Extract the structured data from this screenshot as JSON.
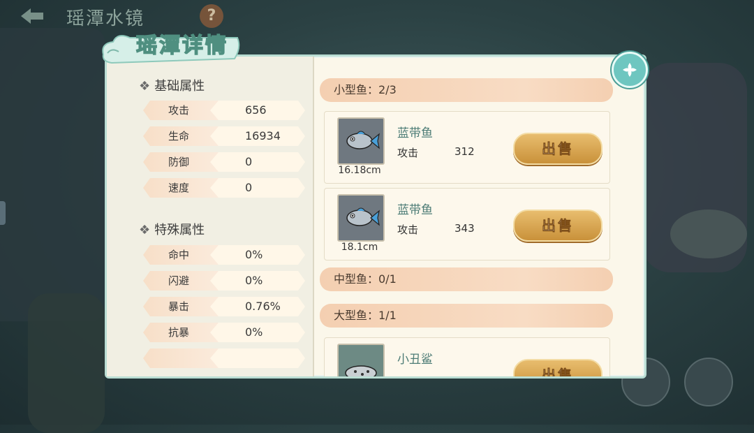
{
  "scene": {
    "title": "瑶潭水镜",
    "help_label": "?"
  },
  "panel": {
    "title": "瑶潭详情"
  },
  "basic_section": {
    "title": "基础属性",
    "stats": [
      {
        "label": "攻击",
        "value": "656"
      },
      {
        "label": "生命",
        "value": "16934"
      },
      {
        "label": "防御",
        "value": "0"
      },
      {
        "label": "速度",
        "value": "0"
      }
    ]
  },
  "special_section": {
    "title": "特殊属性",
    "stats": [
      {
        "label": "命中",
        "value": "0%"
      },
      {
        "label": "闪避",
        "value": "0%"
      },
      {
        "label": "暴击",
        "value": "0.76%"
      },
      {
        "label": "抗暴",
        "value": "0%"
      }
    ]
  },
  "fish_list": {
    "small": {
      "label": "小型鱼：2/3"
    },
    "medium": {
      "label": "中型鱼：0/1"
    },
    "large": {
      "label": "大型鱼：1/1"
    },
    "fishes": [
      {
        "name": "蓝带鱼",
        "size": "16.18cm",
        "attr_label": "攻击",
        "attr_value": "312",
        "sell_label": "出售"
      },
      {
        "name": "蓝带鱼",
        "size": "18.1cm",
        "attr_label": "攻击",
        "attr_value": "343",
        "sell_label": "出售"
      },
      {
        "name": "小丑鲨",
        "size": "",
        "attr_label": "",
        "attr_value": "",
        "sell_label": "出售"
      }
    ]
  },
  "colors": {
    "panel_bg": "#fbf7ea",
    "accent_teal": "#6ec6c0",
    "sell_gold": "#d9a552",
    "category_bar": "#f6d6bc"
  }
}
